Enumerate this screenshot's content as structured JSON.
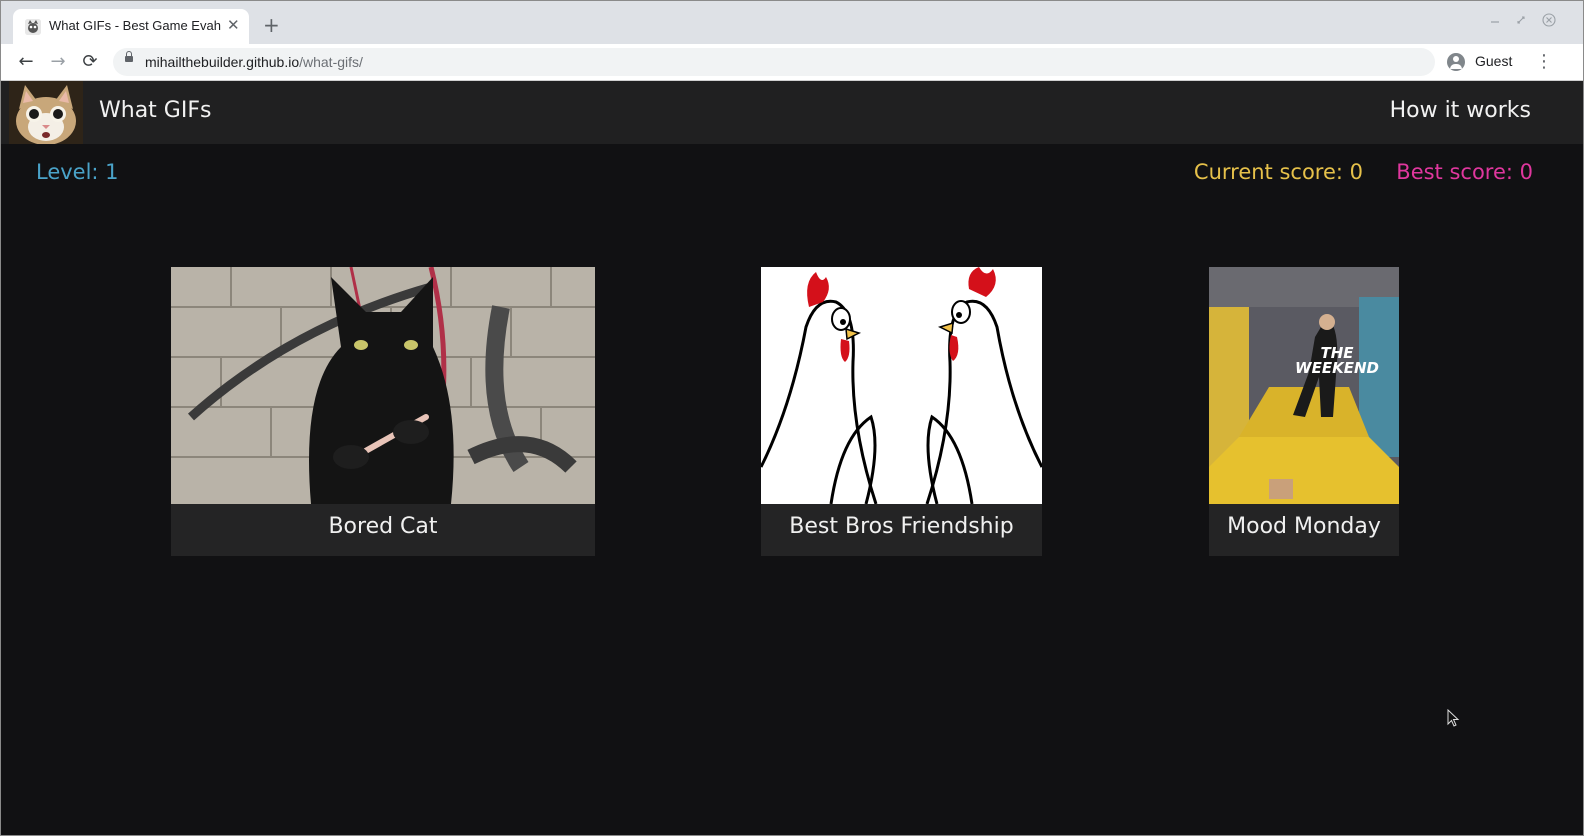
{
  "browser": {
    "tab_title": "What GIFs - Best Game Evah",
    "tab_close": "✕",
    "new_tab": "+",
    "url_host": "mihailthebuilder.github.io",
    "url_path": "/what-gifs/",
    "profile_label": "Guest",
    "back": "←",
    "forward": "→",
    "reload": "⟳",
    "menu": "⋮"
  },
  "header": {
    "title": "What GIFs",
    "how_it_works": "How it works"
  },
  "scores": {
    "level": "Level: 1",
    "current": "Current score: 0",
    "best": "Best score: 0"
  },
  "cards": [
    {
      "label": "Bored Cat",
      "icon": "black-cat-nail-file-gif"
    },
    {
      "label": "Best Bros Friendship",
      "icon": "two-chickens-gif"
    },
    {
      "label": "Mood Monday",
      "icon": "the-weekend-gif",
      "overlay_line1": "THE",
      "overlay_line2": "WEEKEND"
    }
  ],
  "colors": {
    "level": "#4aa3c9",
    "current_score": "#e6c14a",
    "best_score": "#e0379e",
    "background": "#111113",
    "header": "#202021"
  }
}
